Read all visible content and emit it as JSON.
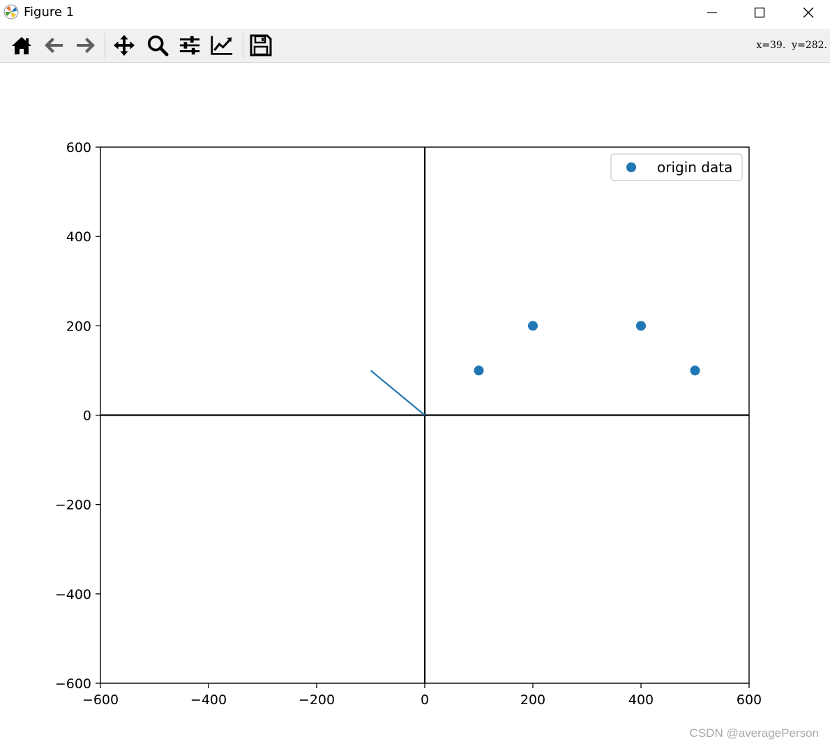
{
  "window": {
    "title": "Figure 1"
  },
  "toolbar": {
    "tools": [
      "home-icon",
      "back-arrow-icon",
      "forward-arrow-icon",
      "pan-icon",
      "zoom-icon",
      "configure-subplots-icon",
      "edit-axis-icon",
      "save-icon"
    ],
    "coordinates": "x=39.  y=282."
  },
  "chart_data": {
    "type": "scatter",
    "xlim": [
      -600,
      600
    ],
    "ylim": [
      -600,
      600
    ],
    "xticks": [
      -600,
      -400,
      -200,
      0,
      200,
      400,
      600
    ],
    "yticks": [
      -600,
      -400,
      -200,
      0,
      200,
      400,
      600
    ],
    "tick_labels_x": [
      "−600",
      "−400",
      "−200",
      "0",
      "200",
      "400",
      "600"
    ],
    "tick_labels_y": [
      "−600",
      "−400",
      "−200",
      "0",
      "200",
      "400",
      "600"
    ],
    "series": [
      {
        "name": "origin data",
        "kind": "scatter",
        "color": "#1f77b4",
        "points": [
          [
            100,
            100
          ],
          [
            200,
            200
          ],
          [
            400,
            200
          ],
          [
            500,
            100
          ]
        ]
      },
      {
        "kind": "line",
        "color": "#1f77b4",
        "points": [
          [
            -100,
            100
          ],
          [
            0,
            0
          ]
        ]
      }
    ],
    "reference_lines": {
      "x0": true,
      "y0": true,
      "color": "#000000"
    },
    "legend": {
      "placement": "top-right",
      "entries": [
        "origin data"
      ]
    },
    "grid": false
  },
  "watermark": "CSDN @averagePerson"
}
